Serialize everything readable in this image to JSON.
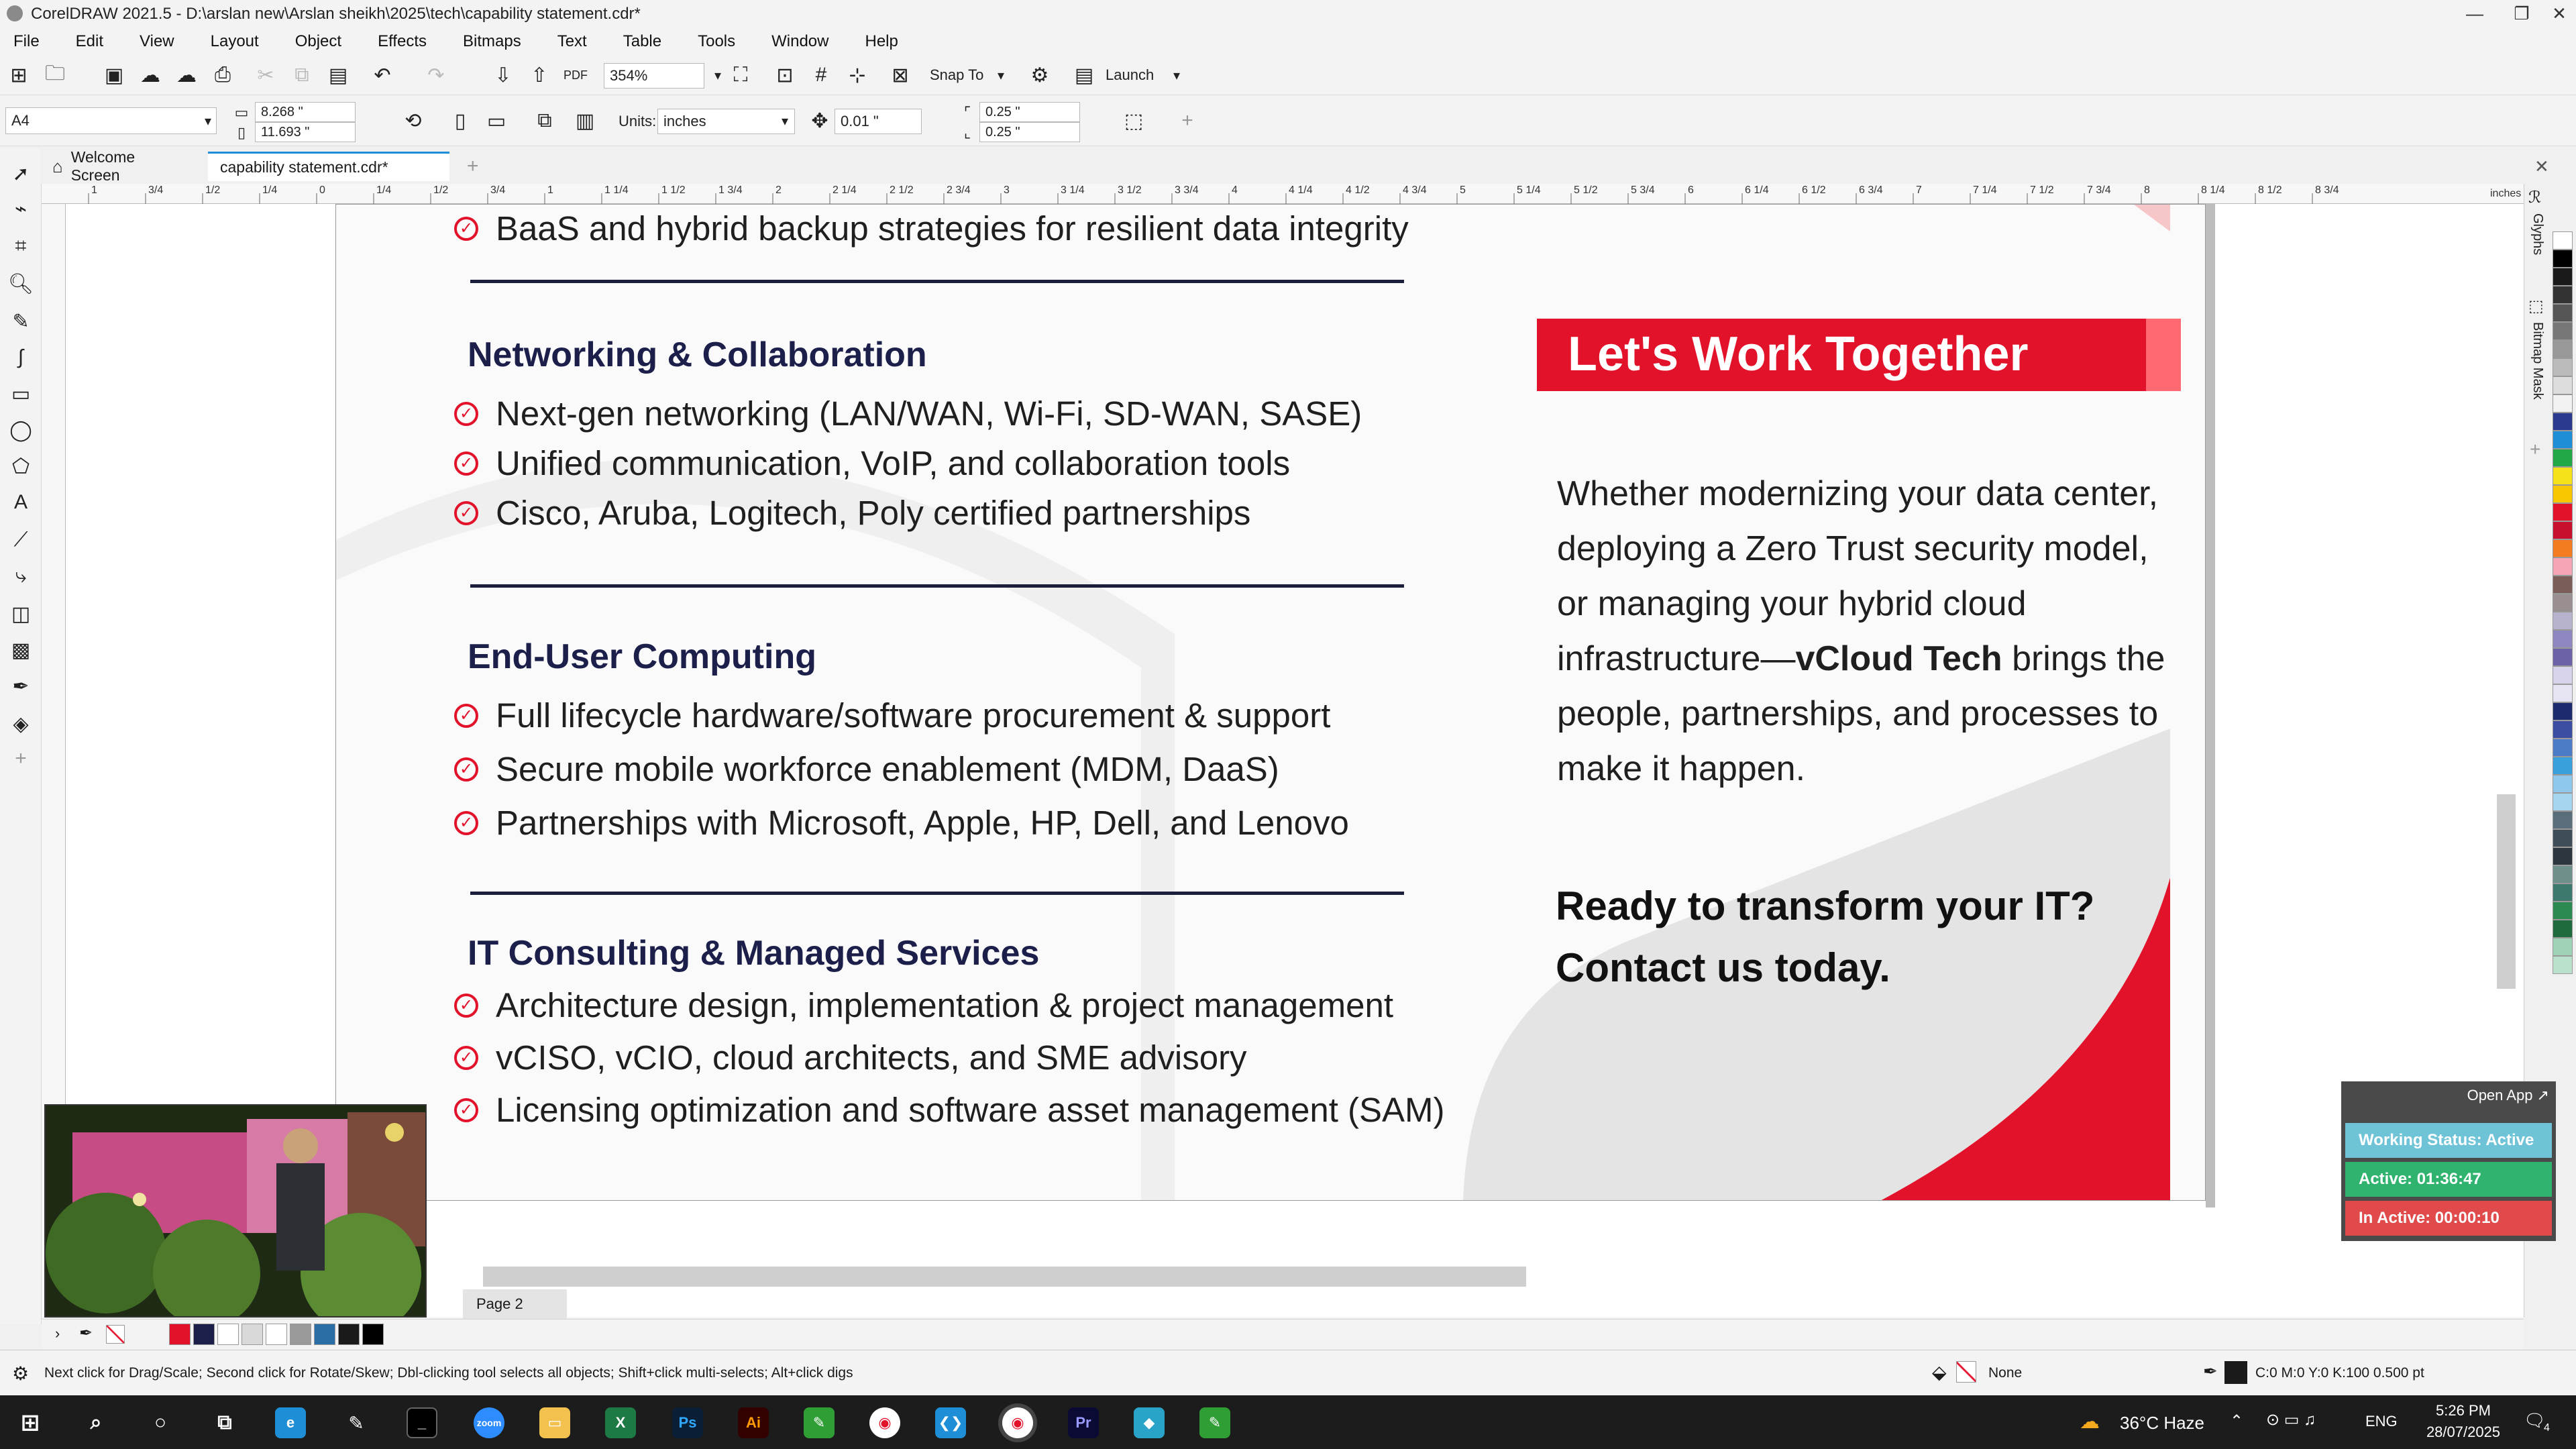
{
  "window": {
    "title": "CorelDRAW 2021.5 - D:\\arslan new\\Arslan sheikh\\2025\\tech\\capability statement.cdr*"
  },
  "menu": [
    "File",
    "Edit",
    "View",
    "Layout",
    "Object",
    "Effects",
    "Bitmaps",
    "Text",
    "Table",
    "Tools",
    "Window",
    "Help"
  ],
  "toolbar": {
    "zoom": "354%",
    "snap_label": "Snap To",
    "launch_label": "Launch"
  },
  "propbar": {
    "page_size": "A4",
    "width": "8.268 \"",
    "height": "11.693 \"",
    "units_label": "Units:",
    "units_value": "inches",
    "nudge": "0.01 \"",
    "dup_x": "0.25 \"",
    "dup_y": "0.25 \""
  },
  "tabs": {
    "welcome": "Welcome Screen",
    "document": "capability statement.cdr*"
  },
  "ruler": {
    "unit": "inches",
    "labels": [
      "1",
      "3/4",
      "1/2",
      "1/4",
      "0",
      "1/4",
      "1/2",
      "3/4",
      "1",
      "1 1/4",
      "1 1/2",
      "1 3/4",
      "2",
      "2 1/4",
      "2 1/2",
      "2 3/4",
      "3",
      "3 1/4",
      "3 1/2",
      "3 3/4",
      "4",
      "4 1/4",
      "4 1/2",
      "4 3/4",
      "5",
      "5 1/4",
      "5 1/2",
      "5 3/4",
      "6",
      "6 1/4",
      "6 1/2",
      "6 3/4",
      "7",
      "7 1/4",
      "7 1/2",
      "7 3/4",
      "8",
      "8 1/4",
      "8 1/2",
      "8 3/4"
    ]
  },
  "document": {
    "top_bullet": "BaaS and hybrid backup strategies for resilient data integrity",
    "sections": [
      {
        "heading": "Networking & Collaboration",
        "items": [
          "Next-gen networking (LAN/WAN, Wi-Fi, SD-WAN, SASE)",
          "Unified communication, VoIP, and collaboration tools",
          "Cisco, Aruba, Logitech, Poly certified partnerships"
        ]
      },
      {
        "heading": "End-User Computing",
        "items": [
          "Full lifecycle hardware/software procurement & support",
          "Secure mobile workforce enablement (MDM, DaaS)",
          "Partnerships with Microsoft, Apple, HP, Dell, and Lenovo"
        ]
      },
      {
        "heading": "IT Consulting & Managed Services",
        "items": [
          "Architecture design, implementation & project management",
          "vCISO, vCIO, cloud architects, and SME advisory",
          "Licensing optimization and software asset management (SAM)"
        ]
      }
    ],
    "ribbon_title": "Let's Work Together",
    "paragraph_pre": "Whether modernizing your data center, deploying a Zero Trust security model, or managing your hybrid cloud infrastructure—",
    "paragraph_bold": "vCloud Tech",
    "paragraph_post": " brings the people, partnerships, and processes to make it happen.",
    "cta_line1": "Ready to transform your IT?",
    "cta_line2": "Contact us today."
  },
  "dock": {
    "glyphs": "Glyphs",
    "bitmap_mask": "Bitmap Mask"
  },
  "tracker": {
    "open_app": "Open App ↗",
    "working_status": "Working Status: Active",
    "active": "Active: 01:36:47",
    "inactive": "In Active: 00:00:10"
  },
  "page_tab": "Page 2",
  "status": {
    "hint": "Next click for Drag/Scale; Second click for Rotate/Skew; Dbl-clicking tool selects all objects; Shift+click multi-selects; Alt+click digs",
    "fill": "None",
    "outline": "C:0 M:0 Y:0 K:100  0.500 pt"
  },
  "taskbar": {
    "weather": "36°C  Haze",
    "lang": "ENG",
    "time": "5:26 PM",
    "date": "28/07/2025",
    "notifications": "4"
  },
  "colors": {
    "accent_red": "#e3122b",
    "heading_navy": "#1b1f4a",
    "tracker_blue": "#6ec3d6",
    "tracker_green": "#2fb36e",
    "tracker_red": "#e04a4a"
  },
  "palette": [
    "#ffffff",
    "#000000",
    "#1a1a1a",
    "#333333",
    "#555555",
    "#777777",
    "#999999",
    "#bbbbbb",
    "#dddddd",
    "#f2f2f2",
    "#2b3a8f",
    "#1e8fd6",
    "#22a847",
    "#f5e21a",
    "#f7c600",
    "#e3122b",
    "#c8102e",
    "#f47c20",
    "#f4a6b7",
    "#7a5c58",
    "#9a8f8f",
    "#b7b3cf",
    "#8d88c0",
    "#6a63a8",
    "#d6d3ea",
    "#e6e4f3",
    "#1c2a6e",
    "#3b4ea3",
    "#4c7cc8",
    "#3aa0dc",
    "#8fc8ea",
    "#a6d6ee",
    "#5a6d7a",
    "#3f4d58",
    "#2b363f",
    "#6f8f8a",
    "#3d7a6d",
    "#2b8a4f",
    "#1f6b3e",
    "#9fd3b8",
    "#b9e1cc"
  ],
  "doc_palette": [
    "#e3122b",
    "#1b1f4a",
    "#ffffff",
    "#d9d9d9",
    "#ffffff",
    "#9a9a9a",
    "#2b6ea5",
    "#1a1a1a",
    "#000000"
  ]
}
